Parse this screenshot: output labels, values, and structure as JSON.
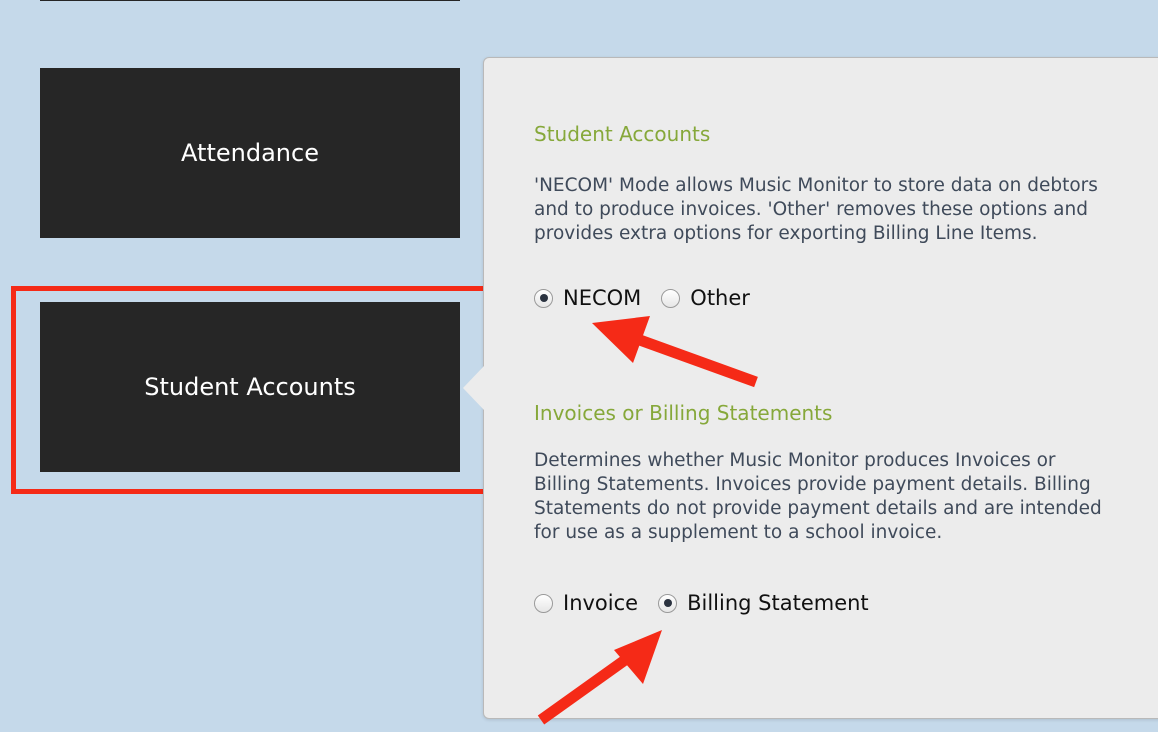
{
  "nav": {
    "items": [
      {
        "label": "Attendance"
      },
      {
        "label": "Student Accounts"
      }
    ]
  },
  "student_accounts": {
    "heading": "Student Accounts",
    "description": "'NECOM' Mode allows Music Monitor to store data on debtors and to produce invoices. 'Other' removes these options and provides extra options for exporting Billing Line Items.",
    "options": [
      {
        "label": "NECOM",
        "checked": true
      },
      {
        "label": "Other",
        "checked": false
      }
    ]
  },
  "invoices": {
    "heading": "Invoices or Billing Statements",
    "description": "Determines whether Music Monitor produces Invoices or Billing Statements. Invoices provide payment details. Billing Statements do not provide payment details and are intended for use as a supplement to a school invoice.",
    "options": [
      {
        "label": "Invoice",
        "checked": false
      },
      {
        "label": "Billing Statement",
        "checked": true
      }
    ]
  },
  "colors": {
    "background": "#c5d9ea",
    "tile": "#262626",
    "heading": "#86a83a",
    "annotation": "#f52a17"
  }
}
